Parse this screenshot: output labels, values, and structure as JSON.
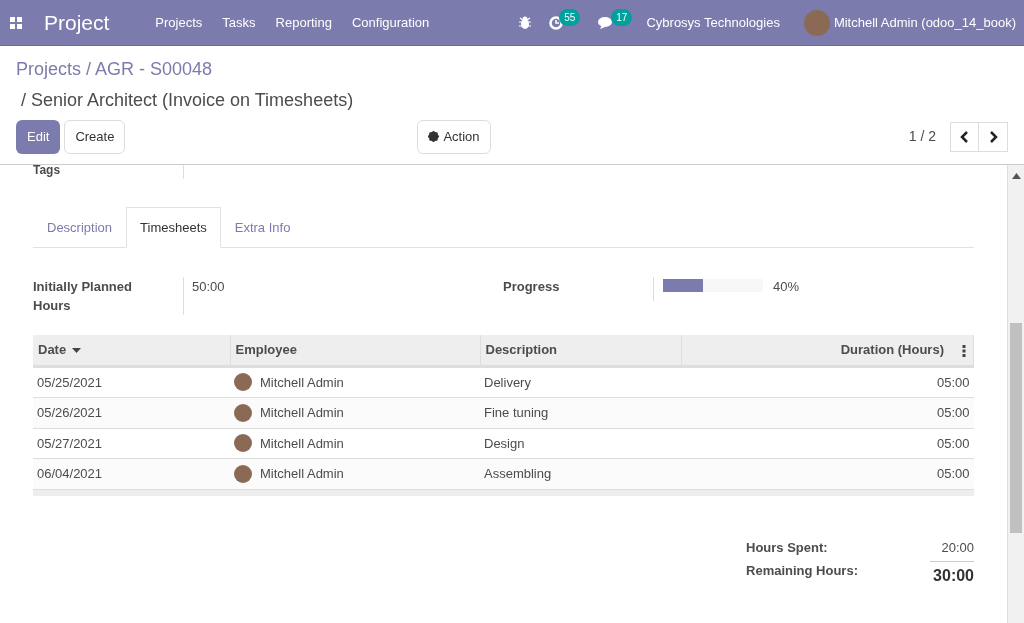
{
  "navbar": {
    "app_title": "Project",
    "menu": [
      "Projects",
      "Tasks",
      "Reporting",
      "Configuration"
    ],
    "activity_count": "55",
    "message_count": "17",
    "company": "Cybrosys Technologies",
    "user": "Mitchell Admin (odoo_14_book)"
  },
  "breadcrumb": {
    "parent": "Projects / AGR - S00048",
    "current": "/ Senior Architect (Invoice on Timesheets)"
  },
  "buttons": {
    "edit": "Edit",
    "create": "Create",
    "action": "Action"
  },
  "pager": "1 / 2",
  "tags_label": "Tags",
  "tabs": [
    {
      "label": "Description",
      "selected": false
    },
    {
      "label": "Timesheets",
      "selected": true
    },
    {
      "label": "Extra Info",
      "selected": false
    }
  ],
  "planned": {
    "label": "Initially Planned Hours",
    "value": "50:00"
  },
  "progress": {
    "label": "Progress",
    "level": 0.4,
    "reading": "40%"
  },
  "table": {
    "columns": [
      "Date",
      "Employee",
      "Description",
      "Duration (Hours)"
    ],
    "rows": [
      {
        "date": "05/25/2021",
        "employee": "Mitchell Admin",
        "description": "Delivery",
        "duration": "05:00"
      },
      {
        "date": "05/26/2021",
        "employee": "Mitchell Admin",
        "description": "Fine tuning",
        "duration": "05:00"
      },
      {
        "date": "05/27/2021",
        "employee": "Mitchell Admin",
        "description": "Design",
        "duration": "05:00"
      },
      {
        "date": "06/04/2021",
        "employee": "Mitchell Admin",
        "description": "Assembling",
        "duration": "05:00"
      }
    ]
  },
  "totals": {
    "spent_label": "Hours Spent:",
    "spent": "20:00",
    "remaining_label": "Remaining Hours:",
    "remaining": "30:00"
  }
}
